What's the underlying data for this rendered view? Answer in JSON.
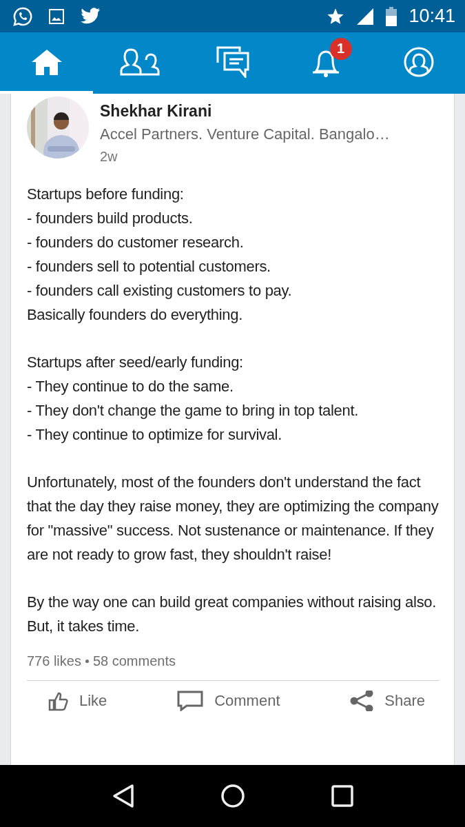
{
  "status_bar": {
    "time": "10:41"
  },
  "tabs": [
    {
      "kind": "home",
      "selected": true
    },
    {
      "kind": "network",
      "selected": false
    },
    {
      "kind": "messages",
      "selected": false
    },
    {
      "kind": "notifications",
      "selected": false,
      "badge": "1"
    },
    {
      "kind": "profile",
      "selected": false
    }
  ],
  "post": {
    "author": "Shekhar Kirani",
    "headline": "Accel Partners. Venture Capital. Bangalo…",
    "time": "2w",
    "body": [
      "Startups before funding:\n - founders build products.\n - founders do customer research.\n - founders sell to potential customers.\n - founders call existing customers to pay.\nBasically founders do everything.",
      "Startups after seed/early funding:\n - They continue to do the same.\n - They don't change the game to bring in top talent.\n - They continue to optimize for survival.",
      "Unfortunately, most of the founders don't understand the fact that the day they raise money, they are optimizing the company for \"massive\" success. Not sustenance or maintenance. If they are not ready to grow fast, they shouldn't raise!",
      "By the way one can build great companies without raising also. But, it takes time."
    ],
    "likes": "776 likes",
    "comments": "58 comments",
    "actions": [
      {
        "kind": "like",
        "label": "Like"
      },
      {
        "kind": "comment",
        "label": "Comment"
      },
      {
        "kind": "share",
        "label": "Share"
      }
    ]
  }
}
